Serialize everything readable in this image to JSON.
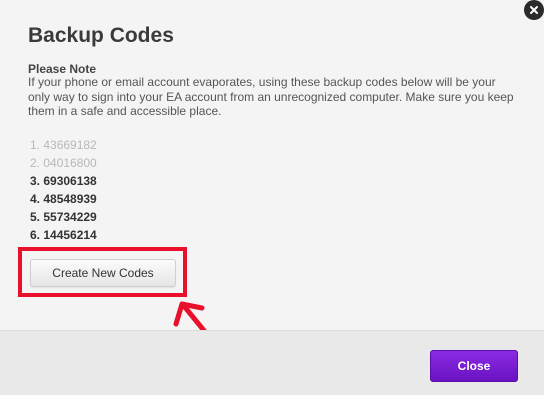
{
  "dialog": {
    "title": "Backup Codes",
    "note_heading": "Please Note",
    "note_text": "If your phone or email account evaporates, using these backup codes below will be your only way to sign into your EA account from an unrecognized computer. Make sure you keep them in a safe and accessible place.",
    "codes": [
      {
        "label": "1. 43669182",
        "used": true
      },
      {
        "label": "2. 04016800",
        "used": true
      },
      {
        "label": "3. 69306138",
        "used": false
      },
      {
        "label": "4. 48548939",
        "used": false
      },
      {
        "label": "5. 55734229",
        "used": false
      },
      {
        "label": "6. 14456214",
        "used": false
      }
    ],
    "create_button_label": "Create New Codes",
    "close_button_label": "Close",
    "close_icon": "close-x-icon"
  },
  "colors": {
    "accent_purple": "#7b1fd6",
    "annotation_red": "#e8102a",
    "used_code_gray": "#b8b8b8"
  }
}
